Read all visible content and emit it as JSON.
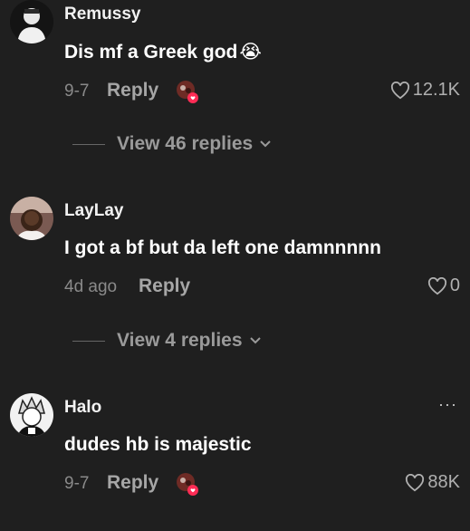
{
  "comments": [
    {
      "username": "Remussy",
      "text": "Dis mf a Greek god",
      "emoji": "😭",
      "date": "9-7",
      "reply_label": "Reply",
      "likes": "12.1K",
      "view_replies": "View 46 replies",
      "reply_avatar_color": "#7a2a22"
    },
    {
      "username": "LayLay",
      "text": "I got a bf but da left one damnnnnn",
      "date": "4d ago",
      "reply_label": "Reply",
      "likes": "0",
      "view_replies": "View 4 replies"
    },
    {
      "username": "Halo",
      "text": "dudes hb is majestic",
      "date": "9-7",
      "reply_label": "Reply",
      "likes": "88K",
      "more": "···",
      "reply_avatar_color": "#7a2a22"
    }
  ],
  "colors": {
    "background": "#1f1f1f",
    "muted_text": "#8a8a8a",
    "reply_badge": "#fe2c55"
  }
}
